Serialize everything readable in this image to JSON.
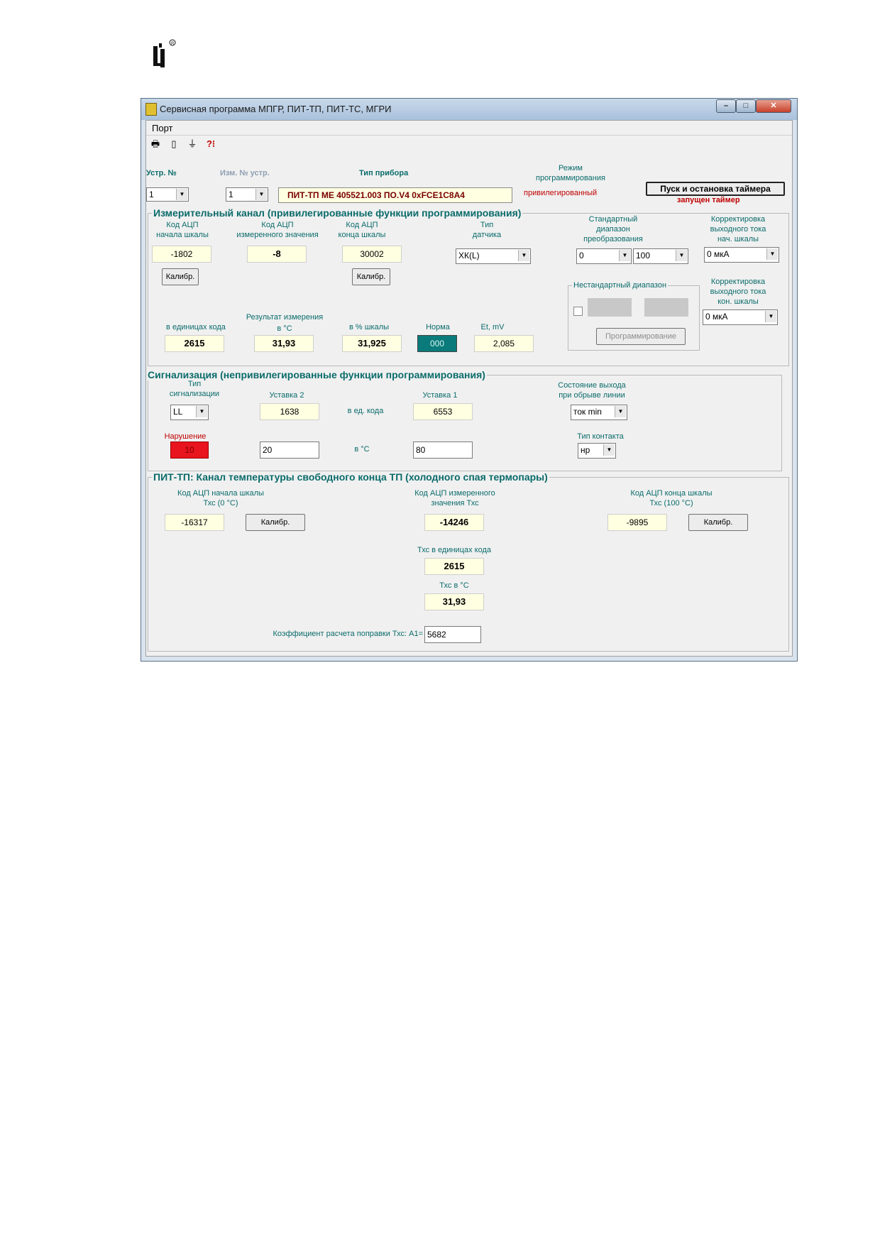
{
  "window": {
    "title": "Сервисная программа МПГР, ПИТ-ТП, ПИТ-ТС, МГРИ",
    "min_icon": "minimize-icon",
    "max_icon": "maximize-icon",
    "close_icon": "close-icon",
    "min_glyph": "–",
    "max_glyph": "□",
    "close_glyph": "✕"
  },
  "menu": {
    "port": "Порт"
  },
  "toolbar": [
    {
      "icon": "printer-icon",
      "glyph": "🖶"
    },
    {
      "icon": "device-icon",
      "glyph": "▯"
    },
    {
      "icon": "filter-icon",
      "glyph": "⏚"
    },
    {
      "icon": "help-icon",
      "glyph": "?⁝"
    }
  ],
  "header": {
    "device_no_label": "Устр. №",
    "device_no_value": "1",
    "change_no_label": "Изм. № устр.",
    "change_no_value": "1",
    "device_type_label": "Тип прибора",
    "device_type_value": "ПИТ-ТП МЕ  405521.003  ПО.V4  0xFCE1C8A4",
    "mode_label_line1": "Режим",
    "mode_label_line2": "программирования",
    "mode_value": "привилегированный",
    "timer_button": "Пуск и остановка таймера",
    "timer_status": "запущен таймер"
  },
  "measuring": {
    "title": "Измерительный канал (привилегированные функции программирования)",
    "adc_start_label1": "Код АЦП",
    "adc_start_label2": "начала шкалы",
    "adc_start_value": "-1802",
    "adc_meas_label1": "Код АЦП",
    "adc_meas_label2": "измеренного значения",
    "adc_meas_value": "-8",
    "adc_end_label1": "Код АЦП",
    "adc_end_label2": "конца шкалы",
    "adc_end_value": "30002",
    "calib_label": "Калибр.",
    "sensor_type_label1": "Тип",
    "sensor_type_label2": "датчика",
    "sensor_type_value": "ХК(L)",
    "std_range_label1": "Стандартный",
    "std_range_label2": "диапазон",
    "std_range_label3": "преобразования",
    "std_range_from": "0",
    "std_range_to": "100",
    "corr_start_label1": "Корректировка",
    "corr_start_label2": "выходного тока",
    "corr_start_label3": "нач. шкалы",
    "corr_start_value": "0 мкА",
    "corr_end_label1": "Корректировка",
    "corr_end_label2": "выходного тока",
    "corr_end_label3": "кон. шкалы",
    "corr_end_value": "0 мкА",
    "nonstd_title": "Нестандартный диапазон",
    "program_button": "Программирование",
    "result_label1": "Результат измерения",
    "result_label2": "в °С",
    "units_label": "в единицах кода",
    "units_value": "2615",
    "celsius_value": "31,93",
    "percent_label": "в % шкалы",
    "percent_value": "31,925",
    "norm_label": "Норма",
    "norm_value": "000",
    "et_label": "Et, mV",
    "et_value": "2,085",
    "norm_color": "#0a7a7a"
  },
  "signal": {
    "title": "Сигнализация (непривилегированные функции программирования)",
    "type_label1": "Тип",
    "type_label2": "сигнализации",
    "type_value": "LL",
    "setpoint2_label": "Уставка 2",
    "setpoint2_code": "1638",
    "setpoint1_label": "Уставка 1",
    "setpoint1_code": "6553",
    "code_units_label": "в ед. кода",
    "setpoint2_celsius": "20",
    "setpoint1_celsius": "80",
    "celsius_label": "в °С",
    "break_state_label1": "Состояние выхода",
    "break_state_label2": "при обрыве линии",
    "break_state_value": "ток min",
    "violation_label": "Нарушение",
    "violation_value": "10",
    "violation_color": "#e8141e",
    "contact_type_label": "Тип контакта",
    "contact_type_value": "нр"
  },
  "coldjunction": {
    "title": "ПИТ-ТП: Канал температуры свободного конца ТП (холодного спая термопары)",
    "start_label1": "Код АЦП начала шкалы",
    "start_label2": "Тхс (0 °С)",
    "start_value": "-16317",
    "meas_label1": "Код АЦП измеренного",
    "meas_label2": "значения Тхс",
    "meas_value": "-14246",
    "end_label1": "Код АЦП конца шкалы",
    "end_label2": "Тхс (100 °С)",
    "end_value": "-9895",
    "calib_label": "Калибр.",
    "units_label": "Тхс в единицах кода",
    "units_value": "2615",
    "celsius_label": "Тхс в °С",
    "celsius_value": "31,93",
    "coef_label": "Коэффициент расчета поправки Тхс:   А1=",
    "coef_value": "5682"
  }
}
